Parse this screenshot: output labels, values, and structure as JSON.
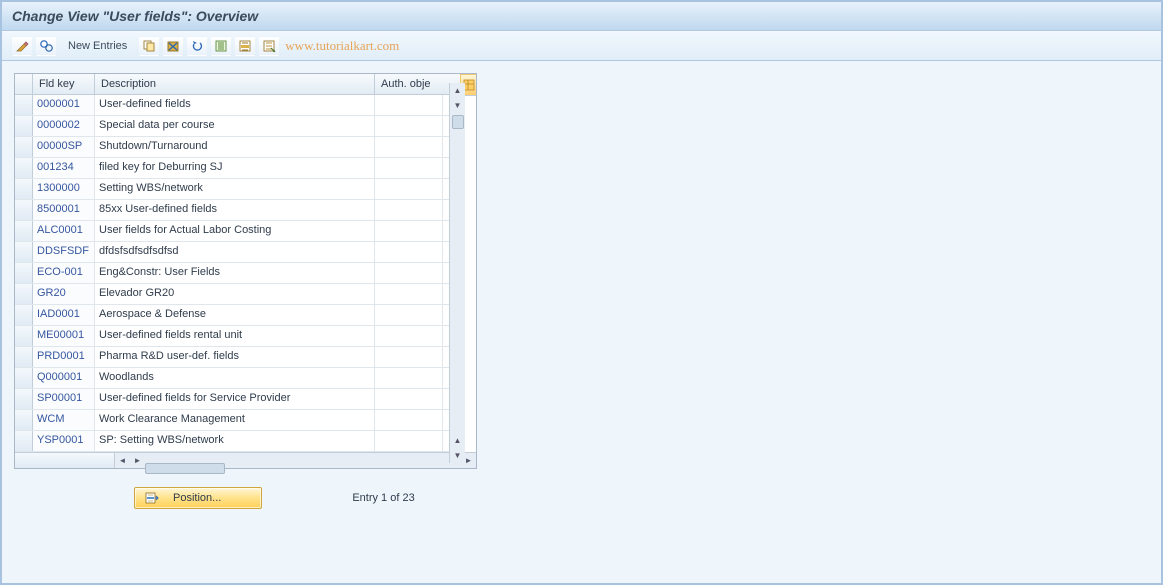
{
  "title": "Change View \"User fields\": Overview",
  "toolbar": {
    "new_entries": "New Entries"
  },
  "watermark": "www.tutorialkart.com",
  "columns": {
    "fld_key": "Fld key",
    "description": "Description",
    "auth_obje": "Auth. obje"
  },
  "rows": [
    {
      "key": "0000001",
      "desc": "User-defined fields",
      "auth": ""
    },
    {
      "key": "0000002",
      "desc": "Special data per course",
      "auth": ""
    },
    {
      "key": "00000SP",
      "desc": "Shutdown/Turnaround",
      "auth": ""
    },
    {
      "key": "001234",
      "desc": "filed key for Deburring SJ",
      "auth": ""
    },
    {
      "key": "1300000",
      "desc": "Setting WBS/network",
      "auth": ""
    },
    {
      "key": "8500001",
      "desc": "85xx User-defined fields",
      "auth": ""
    },
    {
      "key": "ALC0001",
      "desc": "User fields for Actual Labor Costing",
      "auth": ""
    },
    {
      "key": "DDSFSDF",
      "desc": "dfdsfsdfsdfsdfsd",
      "auth": ""
    },
    {
      "key": "ECO-001",
      "desc": "Eng&Constr: User Fields",
      "auth": ""
    },
    {
      "key": "GR20",
      "desc": "Elevador GR20",
      "auth": ""
    },
    {
      "key": "IAD0001",
      "desc": "Aerospace & Defense",
      "auth": ""
    },
    {
      "key": "ME00001",
      "desc": "User-defined fields rental unit",
      "auth": ""
    },
    {
      "key": "PRD0001",
      "desc": "Pharma R&D user-def. fields",
      "auth": ""
    },
    {
      "key": "Q000001",
      "desc": "Woodlands",
      "auth": ""
    },
    {
      "key": "SP00001",
      "desc": "User-defined fields for Service Provider",
      "auth": ""
    },
    {
      "key": "WCM",
      "desc": "Work Clearance Management",
      "auth": ""
    },
    {
      "key": "YSP0001",
      "desc": "SP: Setting WBS/network",
      "auth": ""
    }
  ],
  "footer": {
    "position_label": "Position...",
    "entry_text": "Entry 1 of 23"
  }
}
